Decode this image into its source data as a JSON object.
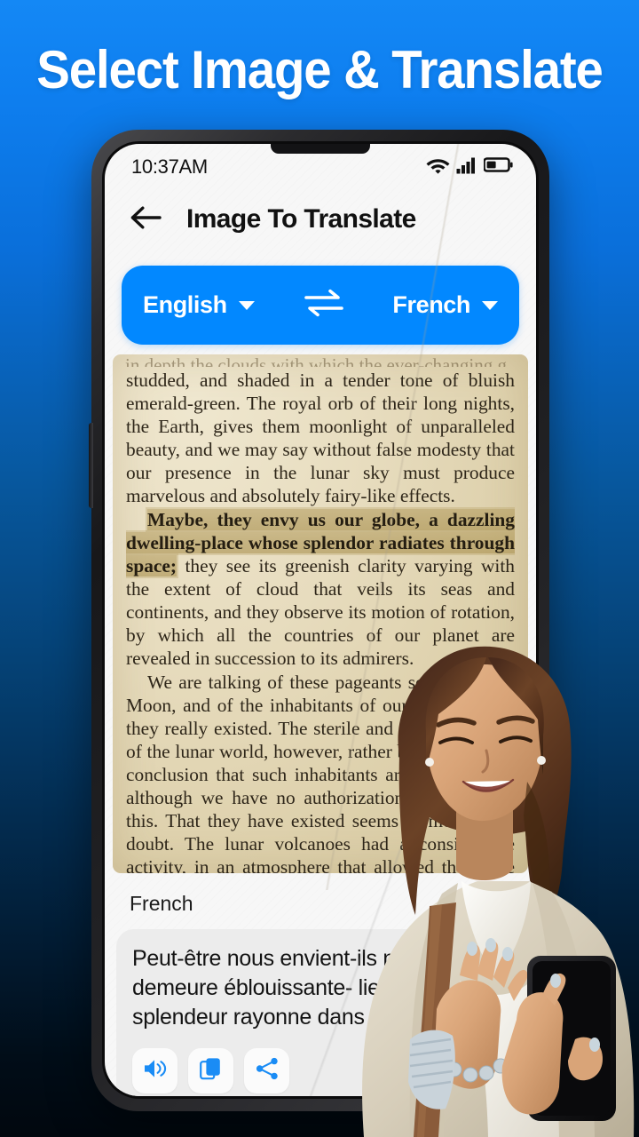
{
  "promo": {
    "headline": "Select Image & Translate"
  },
  "phone": {
    "statusbar": {
      "time": "10:37AM",
      "icons": [
        "wifi-icon",
        "cellular-signal-icon",
        "battery-icon"
      ]
    },
    "appbar": {
      "back_icon": "back-arrow-icon",
      "title": "Image To Translate"
    },
    "language_bar": {
      "source_language": "English",
      "target_language": "French",
      "swap_icon": "swap-arrows-icon",
      "dropdown_icon": "chevron-down-icon",
      "background_color": "#0288FF"
    },
    "document": {
      "clipped_top_line": "in depth the clouds with which the ever-changing g",
      "paragraph1": "studded, and shaded in a tender tone of bluish emerald-green.   The royal orb of their long nights, the Earth, gives them moonlight of unparalleled beauty, and we may say without false modesty that our presence in the lunar sky must produce marvelous and absolutely fairy-like effects.",
      "highlighted_text": "Maybe, they envy us our globe, a dazzling dwelling-place whose splendor radiates through space;",
      "paragraph2_rest": " they see its greenish clarity varying with the extent of cloud that veils its seas and continents, and they observe its motion of rotation, by which all the countries of our planet are revealed in succession to its admirers.",
      "paragraph3": "We are talking of these pageants seen from the Moon, and of the inhabitants of our satellite as if they really existed.   The sterile and desolate aspect of the lunar world, however, rather brings us to the conclusion that such inhabitants are non-existent, although we have no authorization for affirming this.   That they have existed seems to me beyond doubt.   The lunar volcanoes had a considerable activity, in an atmosphere that allowed the white volcanic ashes to be carried away by the winds, figuring round the craters the strange",
      "highlight_color": "#a88f4c"
    },
    "translation": {
      "label": "French",
      "text": "Peut-être nous envient-ils notre globe, demeure éblouissante- lieu dont la splendeur rayonne dans l'espace",
      "actions": [
        {
          "name": "speaker-icon",
          "label": "Listen"
        },
        {
          "name": "copy-icon",
          "label": "Copy"
        },
        {
          "name": "share-icon",
          "label": "Share"
        }
      ],
      "accent_color": "#1a8cf5"
    }
  },
  "background": {
    "top_color": "#1488f5",
    "bottom_color": "#01070e"
  }
}
